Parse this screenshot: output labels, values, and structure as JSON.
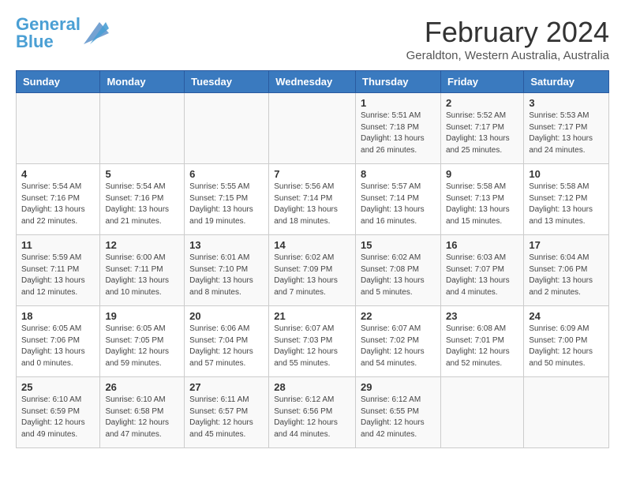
{
  "header": {
    "logo_line1": "General",
    "logo_line2": "Blue",
    "month_title": "February 2024",
    "location": "Geraldton, Western Australia, Australia"
  },
  "columns": [
    "Sunday",
    "Monday",
    "Tuesday",
    "Wednesday",
    "Thursday",
    "Friday",
    "Saturday"
  ],
  "weeks": [
    [
      {
        "day": "",
        "info": ""
      },
      {
        "day": "",
        "info": ""
      },
      {
        "day": "",
        "info": ""
      },
      {
        "day": "",
        "info": ""
      },
      {
        "day": "1",
        "info": "Sunrise: 5:51 AM\nSunset: 7:18 PM\nDaylight: 13 hours\nand 26 minutes."
      },
      {
        "day": "2",
        "info": "Sunrise: 5:52 AM\nSunset: 7:17 PM\nDaylight: 13 hours\nand 25 minutes."
      },
      {
        "day": "3",
        "info": "Sunrise: 5:53 AM\nSunset: 7:17 PM\nDaylight: 13 hours\nand 24 minutes."
      }
    ],
    [
      {
        "day": "4",
        "info": "Sunrise: 5:54 AM\nSunset: 7:16 PM\nDaylight: 13 hours\nand 22 minutes."
      },
      {
        "day": "5",
        "info": "Sunrise: 5:54 AM\nSunset: 7:16 PM\nDaylight: 13 hours\nand 21 minutes."
      },
      {
        "day": "6",
        "info": "Sunrise: 5:55 AM\nSunset: 7:15 PM\nDaylight: 13 hours\nand 19 minutes."
      },
      {
        "day": "7",
        "info": "Sunrise: 5:56 AM\nSunset: 7:14 PM\nDaylight: 13 hours\nand 18 minutes."
      },
      {
        "day": "8",
        "info": "Sunrise: 5:57 AM\nSunset: 7:14 PM\nDaylight: 13 hours\nand 16 minutes."
      },
      {
        "day": "9",
        "info": "Sunrise: 5:58 AM\nSunset: 7:13 PM\nDaylight: 13 hours\nand 15 minutes."
      },
      {
        "day": "10",
        "info": "Sunrise: 5:58 AM\nSunset: 7:12 PM\nDaylight: 13 hours\nand 13 minutes."
      }
    ],
    [
      {
        "day": "11",
        "info": "Sunrise: 5:59 AM\nSunset: 7:11 PM\nDaylight: 13 hours\nand 12 minutes."
      },
      {
        "day": "12",
        "info": "Sunrise: 6:00 AM\nSunset: 7:11 PM\nDaylight: 13 hours\nand 10 minutes."
      },
      {
        "day": "13",
        "info": "Sunrise: 6:01 AM\nSunset: 7:10 PM\nDaylight: 13 hours\nand 8 minutes."
      },
      {
        "day": "14",
        "info": "Sunrise: 6:02 AM\nSunset: 7:09 PM\nDaylight: 13 hours\nand 7 minutes."
      },
      {
        "day": "15",
        "info": "Sunrise: 6:02 AM\nSunset: 7:08 PM\nDaylight: 13 hours\nand 5 minutes."
      },
      {
        "day": "16",
        "info": "Sunrise: 6:03 AM\nSunset: 7:07 PM\nDaylight: 13 hours\nand 4 minutes."
      },
      {
        "day": "17",
        "info": "Sunrise: 6:04 AM\nSunset: 7:06 PM\nDaylight: 13 hours\nand 2 minutes."
      }
    ],
    [
      {
        "day": "18",
        "info": "Sunrise: 6:05 AM\nSunset: 7:06 PM\nDaylight: 13 hours\nand 0 minutes."
      },
      {
        "day": "19",
        "info": "Sunrise: 6:05 AM\nSunset: 7:05 PM\nDaylight: 12 hours\nand 59 minutes."
      },
      {
        "day": "20",
        "info": "Sunrise: 6:06 AM\nSunset: 7:04 PM\nDaylight: 12 hours\nand 57 minutes."
      },
      {
        "day": "21",
        "info": "Sunrise: 6:07 AM\nSunset: 7:03 PM\nDaylight: 12 hours\nand 55 minutes."
      },
      {
        "day": "22",
        "info": "Sunrise: 6:07 AM\nSunset: 7:02 PM\nDaylight: 12 hours\nand 54 minutes."
      },
      {
        "day": "23",
        "info": "Sunrise: 6:08 AM\nSunset: 7:01 PM\nDaylight: 12 hours\nand 52 minutes."
      },
      {
        "day": "24",
        "info": "Sunrise: 6:09 AM\nSunset: 7:00 PM\nDaylight: 12 hours\nand 50 minutes."
      }
    ],
    [
      {
        "day": "25",
        "info": "Sunrise: 6:10 AM\nSunset: 6:59 PM\nDaylight: 12 hours\nand 49 minutes."
      },
      {
        "day": "26",
        "info": "Sunrise: 6:10 AM\nSunset: 6:58 PM\nDaylight: 12 hours\nand 47 minutes."
      },
      {
        "day": "27",
        "info": "Sunrise: 6:11 AM\nSunset: 6:57 PM\nDaylight: 12 hours\nand 45 minutes."
      },
      {
        "day": "28",
        "info": "Sunrise: 6:12 AM\nSunset: 6:56 PM\nDaylight: 12 hours\nand 44 minutes."
      },
      {
        "day": "29",
        "info": "Sunrise: 6:12 AM\nSunset: 6:55 PM\nDaylight: 12 hours\nand 42 minutes."
      },
      {
        "day": "",
        "info": ""
      },
      {
        "day": "",
        "info": ""
      }
    ]
  ]
}
